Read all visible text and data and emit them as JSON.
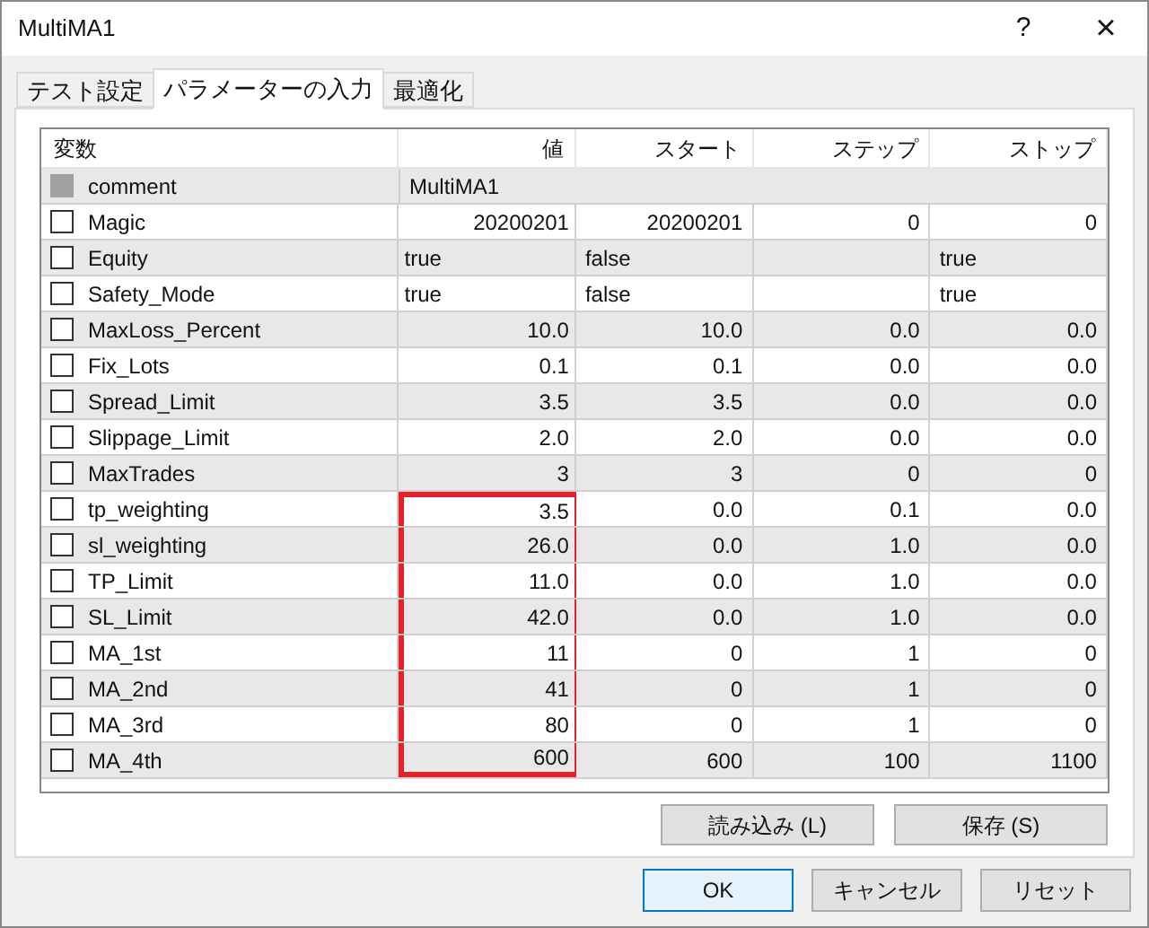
{
  "window": {
    "title": "MultiMA1",
    "help": "?",
    "close": "×"
  },
  "tabs": [
    {
      "label": "テスト設定",
      "selected": false
    },
    {
      "label": "パラメーターの入力",
      "selected": true
    },
    {
      "label": "最適化",
      "selected": false
    }
  ],
  "table": {
    "columns": [
      "変数",
      "値",
      "スタート",
      "ステップ",
      "ストップ"
    ],
    "rows": [
      {
        "kind": "text",
        "name": "comment",
        "checked": false,
        "disabled": true,
        "value": "MultiMA1"
      },
      {
        "kind": "number",
        "name": "Magic",
        "checked": false,
        "disabled": false,
        "value": "20200201",
        "start": "20200201",
        "step": "0",
        "stop": "0"
      },
      {
        "kind": "bool",
        "name": "Equity",
        "checked": false,
        "disabled": false,
        "value": "true",
        "start": "false",
        "stop": "true"
      },
      {
        "kind": "bool",
        "name": "Safety_Mode",
        "checked": false,
        "disabled": false,
        "value": "true",
        "start": "false",
        "stop": "true"
      },
      {
        "kind": "number",
        "name": "MaxLoss_Percent",
        "checked": false,
        "disabled": false,
        "value": "10.0",
        "start": "10.0",
        "step": "0.0",
        "stop": "0.0"
      },
      {
        "kind": "number",
        "name": "Fix_Lots",
        "checked": false,
        "disabled": false,
        "value": "0.1",
        "start": "0.1",
        "step": "0.0",
        "stop": "0.0"
      },
      {
        "kind": "number",
        "name": "Spread_Limit",
        "checked": false,
        "disabled": false,
        "value": "3.5",
        "start": "3.5",
        "step": "0.0",
        "stop": "0.0"
      },
      {
        "kind": "number",
        "name": "Slippage_Limit",
        "checked": false,
        "disabled": false,
        "value": "2.0",
        "start": "2.0",
        "step": "0.0",
        "stop": "0.0"
      },
      {
        "kind": "number",
        "name": "MaxTrades",
        "checked": false,
        "disabled": false,
        "value": "3",
        "start": "3",
        "step": "0",
        "stop": "0"
      },
      {
        "kind": "number",
        "name": "tp_weighting",
        "checked": false,
        "disabled": false,
        "highlighted": true,
        "value": "3.5",
        "start": "0.0",
        "step": "0.1",
        "stop": "0.0"
      },
      {
        "kind": "number",
        "name": "sl_weighting",
        "checked": false,
        "disabled": false,
        "highlighted": true,
        "value": "26.0",
        "start": "0.0",
        "step": "1.0",
        "stop": "0.0"
      },
      {
        "kind": "number",
        "name": "TP_Limit",
        "checked": false,
        "disabled": false,
        "highlighted": true,
        "value": "11.0",
        "start": "0.0",
        "step": "1.0",
        "stop": "0.0"
      },
      {
        "kind": "number",
        "name": "SL_Limit",
        "checked": false,
        "disabled": false,
        "highlighted": true,
        "value": "42.0",
        "start": "0.0",
        "step": "1.0",
        "stop": "0.0"
      },
      {
        "kind": "number",
        "name": "MA_1st",
        "checked": false,
        "disabled": false,
        "highlighted": true,
        "value": "11",
        "start": "0",
        "step": "1",
        "stop": "0"
      },
      {
        "kind": "number",
        "name": "MA_2nd",
        "checked": false,
        "disabled": false,
        "highlighted": true,
        "value": "41",
        "start": "0",
        "step": "1",
        "stop": "0"
      },
      {
        "kind": "number",
        "name": "MA_3rd",
        "checked": false,
        "disabled": false,
        "highlighted": true,
        "value": "80",
        "start": "0",
        "step": "1",
        "stop": "0"
      },
      {
        "kind": "number",
        "name": "MA_4th",
        "checked": false,
        "disabled": false,
        "highlighted": true,
        "value": "600",
        "start": "600",
        "step": "100",
        "stop": "1100"
      }
    ]
  },
  "panel_buttons": [
    "読み込み (L)",
    "保存 (S)"
  ],
  "buttons": [
    {
      "label": "OK",
      "default": true
    },
    {
      "label": "キャンセル",
      "default": false
    },
    {
      "label": "リセット",
      "default": false
    }
  ]
}
